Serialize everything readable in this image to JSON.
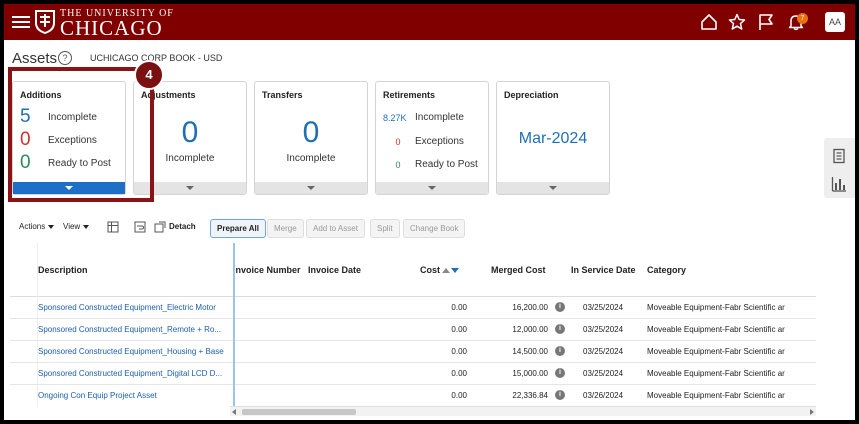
{
  "header": {
    "logo_top": "THE UNIVERSITY OF",
    "logo_main": "CHICAGO",
    "notification_count": "7",
    "avatar_initials": "AA",
    "bg_color": "#800000"
  },
  "page": {
    "title": "Assets",
    "help": "?",
    "book": "UCHICAGO CORP BOOK - USD"
  },
  "tiles": {
    "additions": {
      "title": "Additions",
      "incomplete": "5",
      "incomplete_label": "Incomplete",
      "exceptions": "0",
      "exceptions_label": "Exceptions",
      "ready": "0",
      "ready_label": "Ready to Post"
    },
    "adjustments": {
      "title": "Adjustments",
      "value": "0",
      "label": "Incomplete"
    },
    "transfers": {
      "title": "Transfers",
      "value": "0",
      "label": "Incomplete"
    },
    "retirements": {
      "title": "Retirements",
      "incomplete": "8.27K",
      "incomplete_label": "Incomplete",
      "exceptions": "0",
      "exceptions_label": "Exceptions",
      "ready": "0",
      "ready_label": "Ready to Post"
    },
    "depreciation": {
      "title": "Depreciation",
      "value": "Mar-2024"
    }
  },
  "step_badge": "4",
  "toolbar": {
    "actions": "Actions",
    "view": "View",
    "detach": "Detach",
    "prepare_all": "Prepare All",
    "merge": "Merge",
    "add_to_asset": "Add to Asset",
    "split": "Split",
    "change_book": "Change Book"
  },
  "table": {
    "columns": {
      "description": "Description",
      "invoice_number": "Invoice Number",
      "invoice_date": "Invoice Date",
      "cost": "Cost",
      "merged_cost": "Merged Cost",
      "in_service_date": "In Service Date",
      "category": "Category"
    },
    "rows": [
      {
        "description": "Sponsored Constructed Equipment_Electric Motor",
        "cost": "0.00",
        "merged_cost": "16,200.00",
        "in_service_date": "03/25/2024",
        "category": "Moveable Equipment-Fabr Scientific ar"
      },
      {
        "description": "Sponsored Constructed Equipment_Remote + Ro...",
        "cost": "0.00",
        "merged_cost": "12,000.00",
        "in_service_date": "03/25/2024",
        "category": "Moveable Equipment-Fabr Scientific ar"
      },
      {
        "description": "Sponsored Constructed Equipment_Housing + Base",
        "cost": "0.00",
        "merged_cost": "14,500.00",
        "in_service_date": "03/25/2024",
        "category": "Moveable Equipment-Fabr Scientific ar"
      },
      {
        "description": "Sponsored Constructed Equipment_Digital LCD D...",
        "cost": "0.00",
        "merged_cost": "15,000.00",
        "in_service_date": "03/25/2024",
        "category": "Moveable Equipment-Fabr Scientific ar"
      },
      {
        "description": "Ongoing Con Equip Project Asset",
        "cost": "0.00",
        "merged_cost": "22,336.84",
        "in_service_date": "03/26/2024",
        "category": "Moveable Equipment-Fabr Scientific ar"
      }
    ]
  },
  "colors": {
    "link_blue": "#1f6fb5",
    "incomplete_blue": "#1f6fb5",
    "exception_red": "#d0312d",
    "ready_green": "#2e8b57",
    "highlight": "#8a1414"
  }
}
